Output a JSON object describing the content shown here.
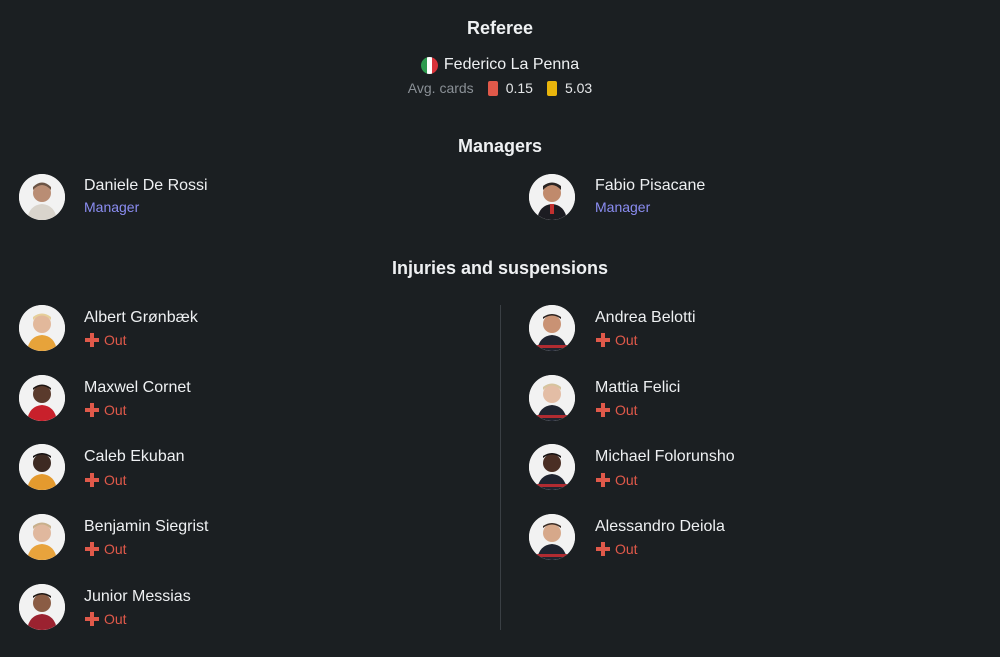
{
  "referee": {
    "title": "Referee",
    "name": "Federico La Penna",
    "flag": "italy-flag-icon",
    "avg_label": "Avg. cards",
    "red_avg": "0.15",
    "yellow_avg": "5.03"
  },
  "managers": {
    "title": "Managers",
    "home": {
      "name": "Daniele De Rossi",
      "role": "Manager"
    },
    "away": {
      "name": "Fabio Pisacane",
      "role": "Manager"
    }
  },
  "injuries": {
    "title": "Injuries and suspensions",
    "home": [
      {
        "name": "Albert Grønbæk",
        "status": "Out"
      },
      {
        "name": "Maxwel Cornet",
        "status": "Out"
      },
      {
        "name": "Caleb Ekuban",
        "status": "Out"
      },
      {
        "name": "Benjamin Siegrist",
        "status": "Out"
      },
      {
        "name": "Junior Messias",
        "status": "Out"
      }
    ],
    "away": [
      {
        "name": "Andrea Belotti",
        "status": "Out"
      },
      {
        "name": "Mattia Felici",
        "status": "Out"
      },
      {
        "name": "Michael Folorunsho",
        "status": "Out"
      },
      {
        "name": "Alessandro Deiola",
        "status": "Out"
      }
    ]
  },
  "colors": {
    "background": "#1b1f22",
    "accent_role": "#8b8df2",
    "status_out": "#e0594a",
    "red_card": "#e0594a",
    "yellow_card": "#e9b50c"
  }
}
